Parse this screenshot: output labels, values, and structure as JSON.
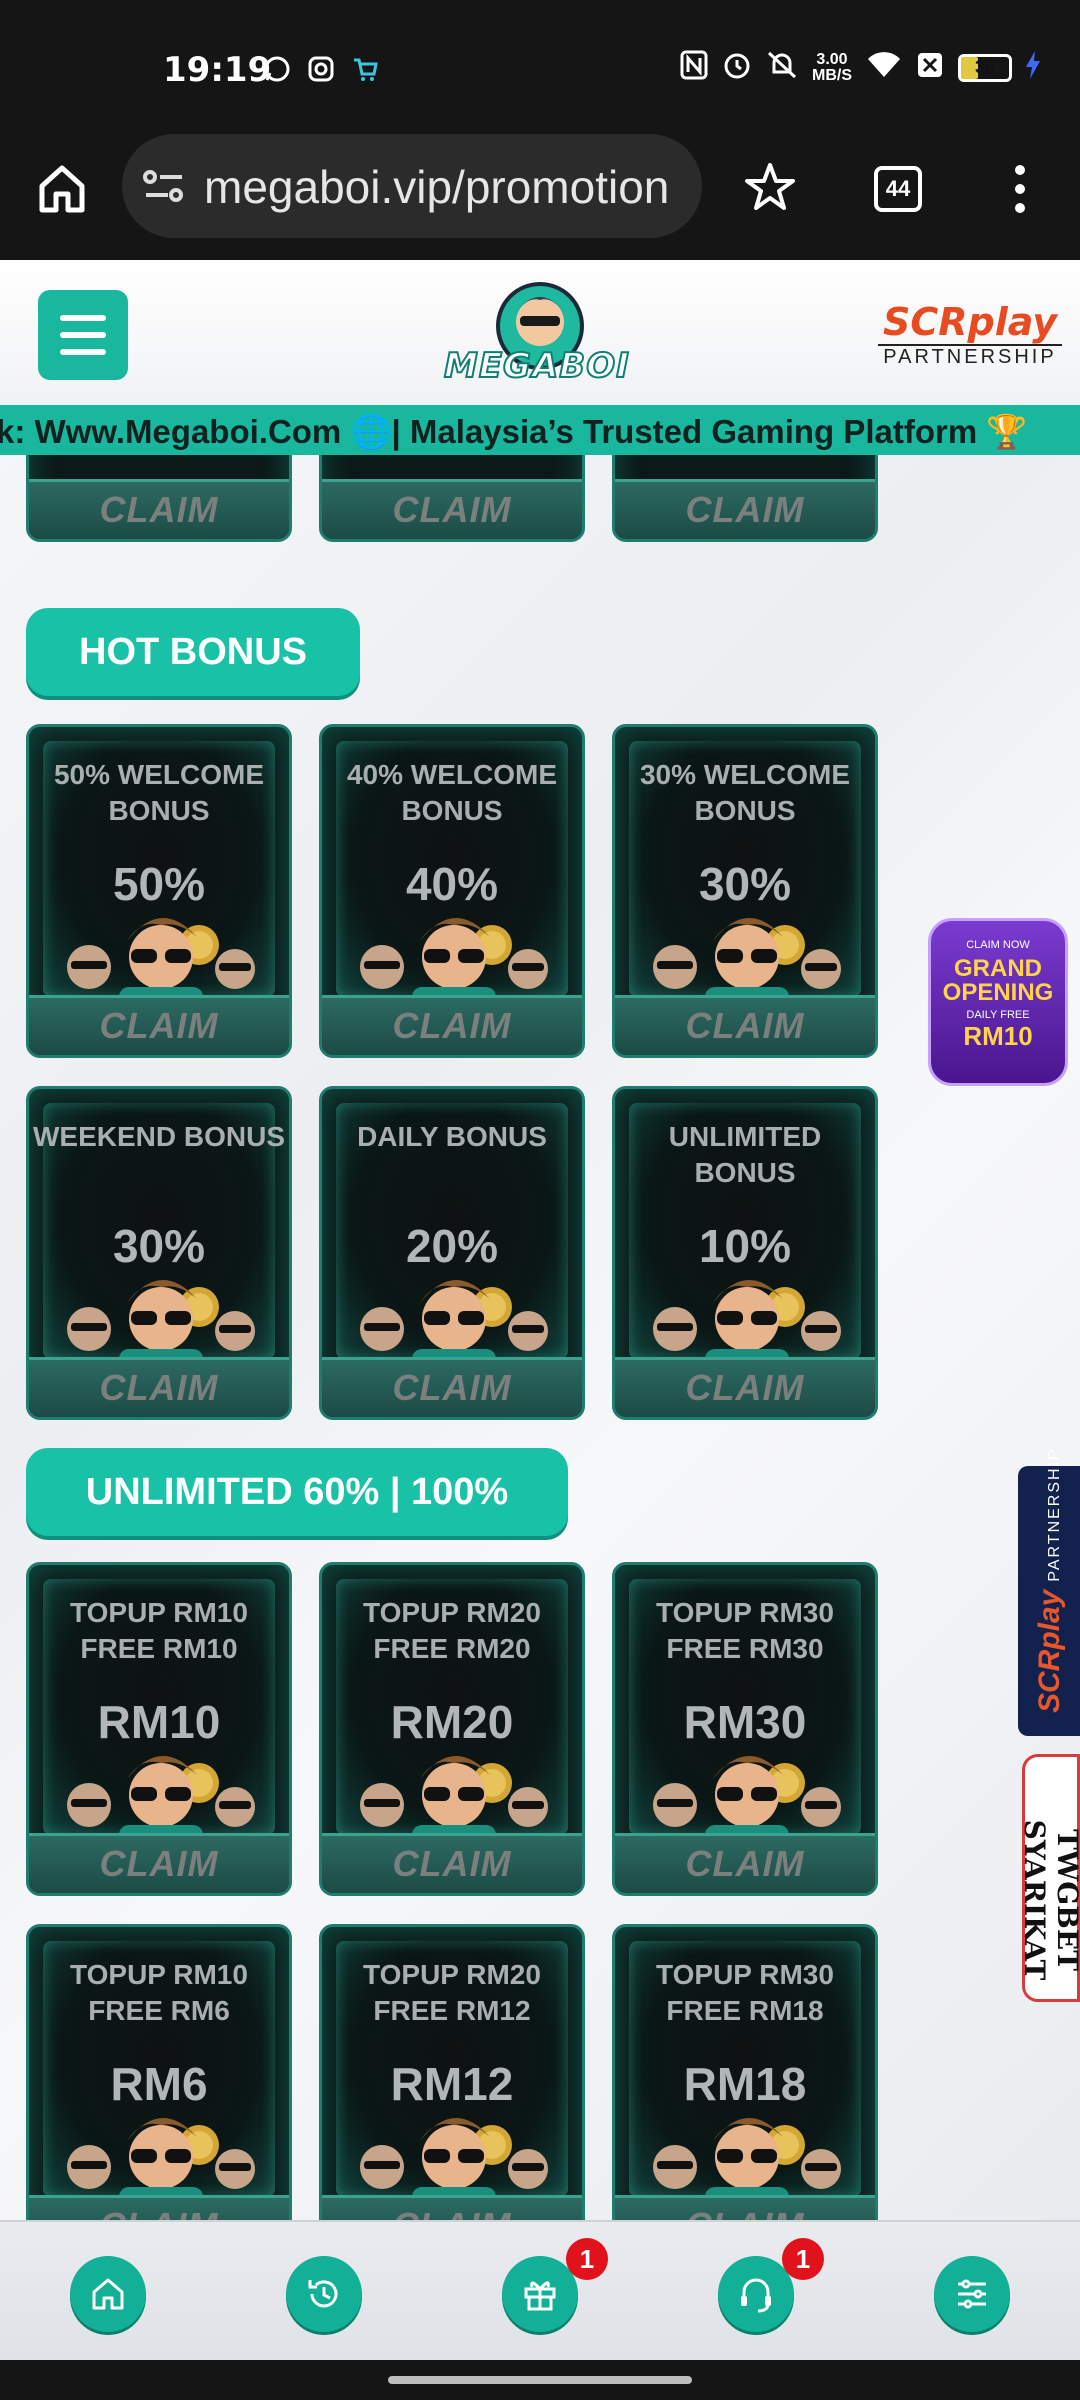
{
  "status_bar": {
    "time": "19:19",
    "speed_top": "3.00",
    "speed_unit": "MB/S",
    "battery": "36",
    "icons": [
      "whatsapp-icon",
      "instagram-icon",
      "cart-icon",
      "nfc-icon",
      "alarm-icon",
      "mute-icon",
      "wifi-icon",
      "close-box-icon",
      "battery-icon",
      "charging-icon"
    ]
  },
  "browser": {
    "url": "megaboi.vip/promotion",
    "tab_count": "44"
  },
  "site": {
    "logo_text": "MEGABOI",
    "partner_brand": "SCRplay",
    "partner_label": "PARTNERSHIP",
    "marquee": "k: Www.Megaboi.Com 🌐| Malaysia’s Trusted Gaming Platform 🏆",
    "claim_label": "CLAIM"
  },
  "sections": [
    {
      "heading": "HOT BONUS",
      "cards": [
        {
          "title": "50% WELCOME BONUS",
          "value": "50%"
        },
        {
          "title": "40% WELCOME BONUS",
          "value": "40%"
        },
        {
          "title": "30% WELCOME BONUS",
          "value": "30%"
        },
        {
          "title": "WEEKEND BONUS",
          "value": "30%"
        },
        {
          "title": "DAILY BONUS",
          "value": "20%"
        },
        {
          "title": "UNLIMITED BONUS",
          "value": "10%"
        }
      ]
    },
    {
      "heading": "UNLIMITED 60% | 100%",
      "cards": [
        {
          "title": "TOPUP RM10 FREE RM10",
          "value": "RM10"
        },
        {
          "title": "TOPUP RM20 FREE RM20",
          "value": "RM20"
        },
        {
          "title": "TOPUP RM30 FREE RM30",
          "value": "RM30"
        },
        {
          "title": "TOPUP RM10 FREE RM6",
          "value": "RM6"
        },
        {
          "title": "TOPUP RM20 FREE RM12",
          "value": "RM12"
        },
        {
          "title": "TOPUP RM30 FREE RM18",
          "value": "RM18"
        }
      ]
    }
  ],
  "side_promo": {
    "line1": "CLAIM NOW",
    "line2": "GRAND OPENING",
    "line3": "DAILY FREE",
    "amount": "RM10"
  },
  "side_tabs": {
    "scr_brand": "SCRplay",
    "scr_label": "PARTNERSHIP",
    "twg_label": "TWGBET SYARIKAT"
  },
  "bottom_nav": {
    "items": [
      "home",
      "history",
      "gift",
      "support",
      "settings"
    ],
    "gift_badge": "1",
    "support_badge": "1"
  },
  "colors": {
    "accent": "#19b79e",
    "card_bg": "#0c1a19",
    "badge": "#e0121c"
  }
}
